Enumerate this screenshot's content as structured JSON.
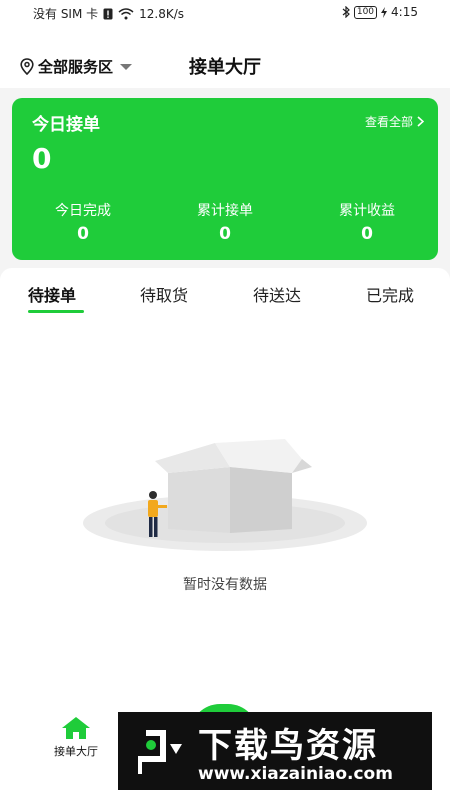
{
  "status_bar": {
    "carrier": "没有 SIM 卡",
    "speed": "12.8K/s",
    "battery": "100",
    "time": "4:15"
  },
  "header": {
    "region": "全部服务区",
    "title": "接单大厅"
  },
  "summary_card": {
    "title": "今日接单",
    "view_all": "查看全部",
    "today_count": "0",
    "stats": [
      {
        "label": "今日完成",
        "value": "0"
      },
      {
        "label": "累计接单",
        "value": "0"
      },
      {
        "label": "累计收益",
        "value": "0"
      }
    ]
  },
  "tabs": [
    "待接单",
    "待取货",
    "待送达",
    "已完成"
  ],
  "active_tab": "待接单",
  "empty_state": {
    "message": "暂时没有数据"
  },
  "bottom_nav": {
    "home_label": "接单大厅"
  },
  "watermark": {
    "title": "下载鸟资源",
    "url": "www.xiazainiao.com"
  },
  "colors": {
    "accent": "#1fcc3a",
    "background": "#f4f4f4"
  },
  "icons": [
    "location-pin-icon",
    "caret-down-icon",
    "chevron-right-icon",
    "home-icon",
    "wifi-icon",
    "bluetooth-icon"
  ]
}
